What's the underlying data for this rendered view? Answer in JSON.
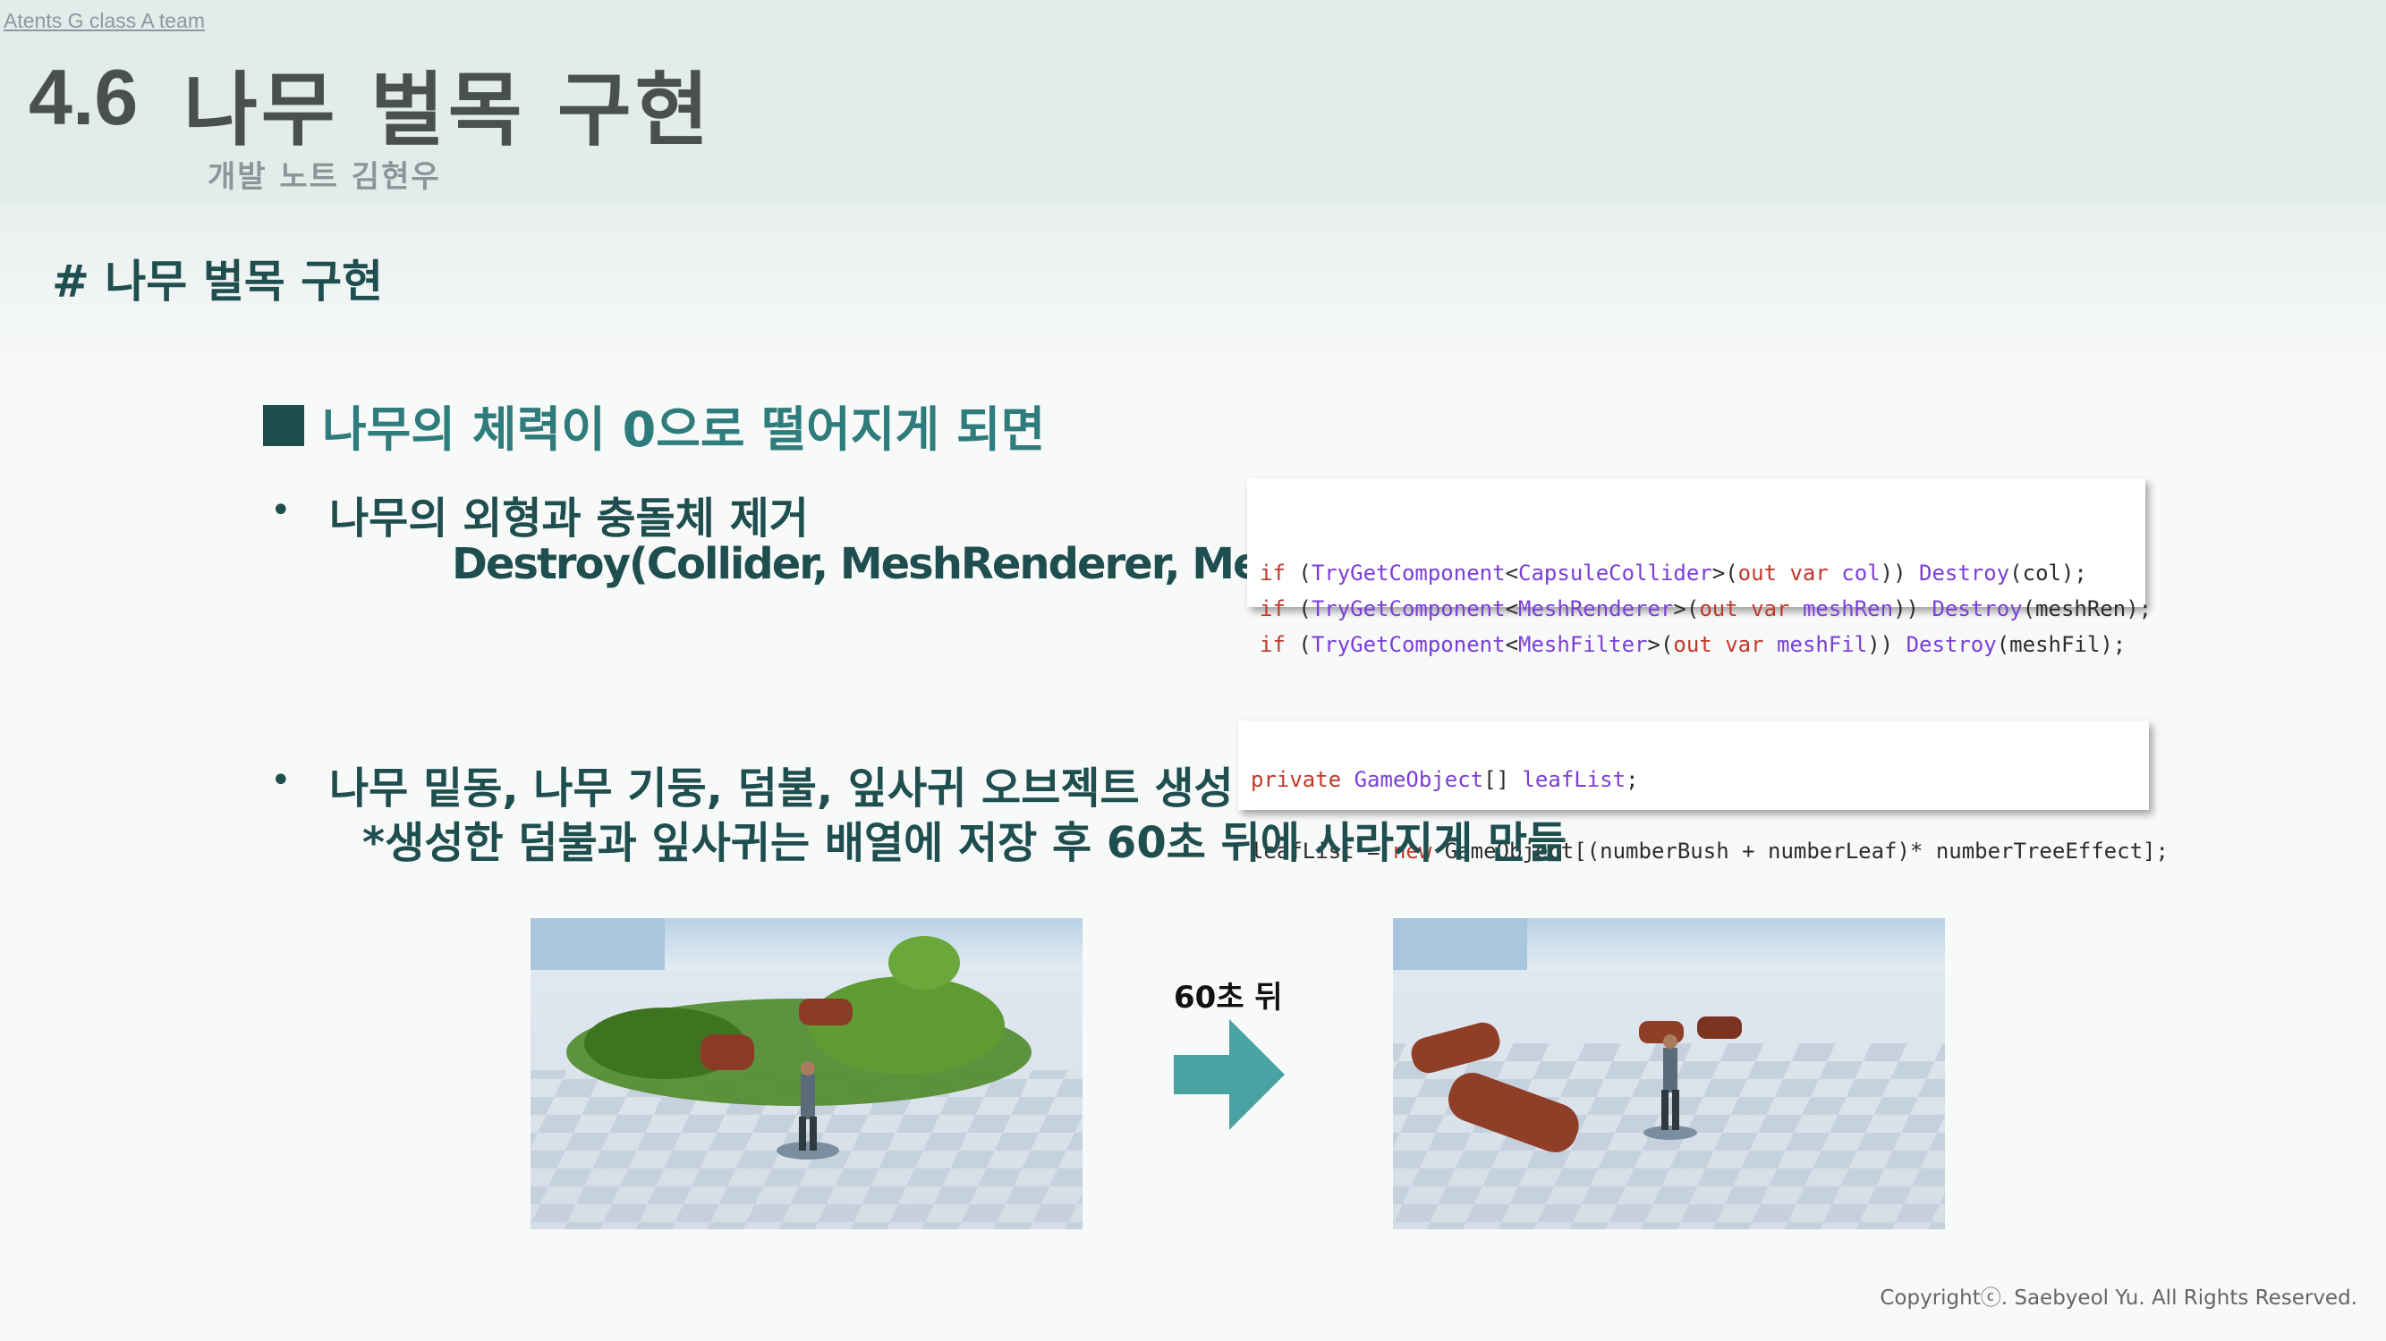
{
  "header": {
    "team_link": "Atents G class A team",
    "section_number": "4.6",
    "title": "나무 벌목 구현",
    "author": "개발 노트 김현우"
  },
  "section_heading": "# 나무 벌목 구현",
  "main_heading": "나무의 체력이 0으로 떨어지게 되면",
  "bullets": [
    {
      "text": "나무의 외형과 충돌체 제거",
      "sub": "Destroy(Collider, MeshRenderer, MeshFilter)"
    },
    {
      "text": "나무 밑동, 나무 기둥, 덤불, 잎사귀 오브젝트 생성",
      "sub": "*생성한 덤불과 잎사귀는 배열에 저장 후 60초 뒤에 사라지게 만듦"
    }
  ],
  "code_1": [
    [
      "if",
      " (",
      "TryGetComponent",
      "<",
      "CapsuleCollider",
      ">(",
      "out",
      " ",
      "var",
      " ",
      "col",
      ")) ",
      "Destroy",
      "(col);"
    ],
    [
      "if",
      " (",
      "TryGetComponent",
      "<",
      "MeshRenderer",
      ">(",
      "out",
      " ",
      "var",
      " ",
      "meshRen",
      ")) ",
      "Destroy",
      "(meshRen);"
    ],
    [
      "if",
      " (",
      "TryGetComponent",
      "<",
      "MeshFilter",
      ">(",
      "out",
      " ",
      "var",
      " ",
      "meshFil",
      ")) ",
      "Destroy",
      "(meshFil);"
    ]
  ],
  "code_2": {
    "line1": {
      "kw": "private",
      "type": "GameObject",
      "rest": "[] ",
      "var": "leafList",
      "end": ";"
    },
    "line2": {
      "a": "leafList = ",
      "kw": "new",
      "b": " GameObject[(numberBush + numberLeaf)* numberTreeEffect];"
    }
  },
  "arrow_label": "60초 뒤",
  "colors": {
    "accent": "#2e7c7c",
    "dark_teal": "#1f4e4e",
    "arrow": "#4aa3a3",
    "header_bg": "#e2ecea"
  },
  "copyright": "Copyrightⓒ. Saebyeol Yu. All Rights Reserved."
}
